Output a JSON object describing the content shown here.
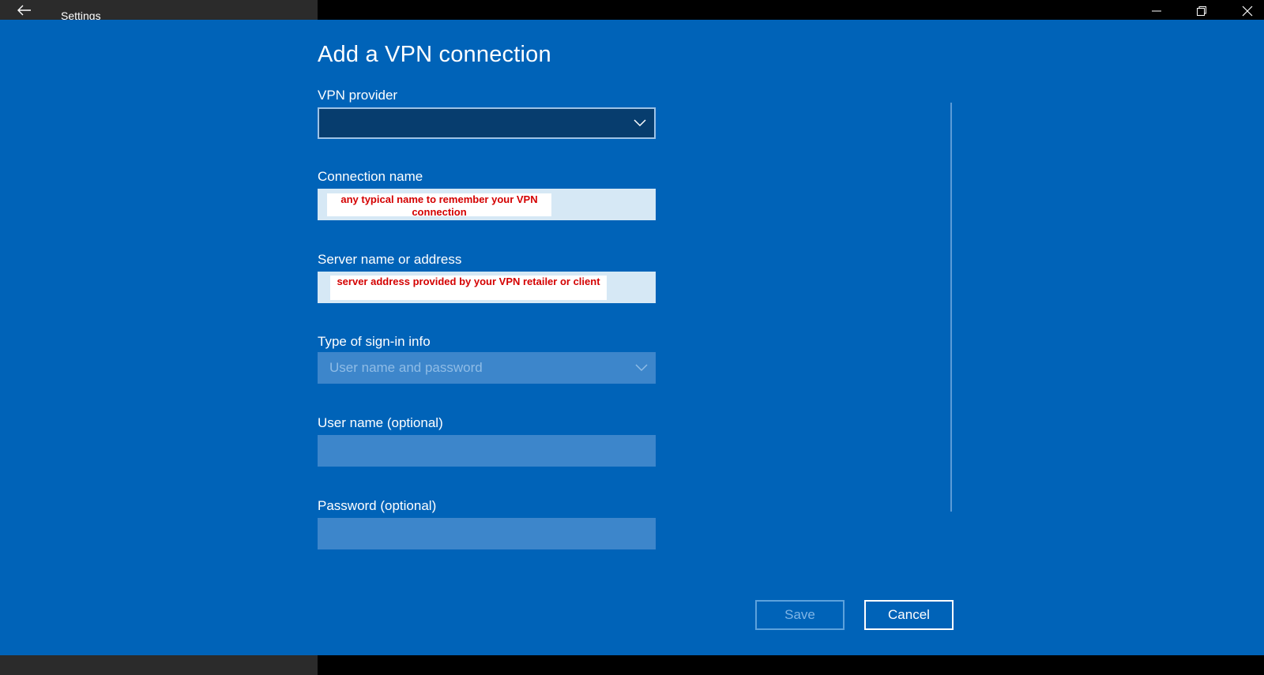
{
  "window": {
    "app_title": "Settings"
  },
  "dialog": {
    "heading": "Add a VPN connection",
    "vpn_provider": {
      "label": "VPN provider",
      "value": ""
    },
    "connection_name": {
      "label": "Connection name",
      "annotation": "any typical name to remember your VPN connection"
    },
    "server": {
      "label": "Server name or address",
      "annotation": "server address provided by your VPN retailer or client"
    },
    "sign_in_type": {
      "label": "Type of sign-in info",
      "value": "User name and password"
    },
    "username": {
      "label": "User name (optional)",
      "value": ""
    },
    "password": {
      "label": "Password (optional)",
      "value": ""
    },
    "buttons": {
      "save": "Save",
      "cancel": "Cancel"
    }
  },
  "colors": {
    "dialog_background": "#0063b8",
    "annotation_text": "#d40000"
  },
  "icons": {
    "back": "back-arrow-icon",
    "dropdown": "chevron-down-icon",
    "minimize": "minimize-icon",
    "restore": "restore-icon",
    "close": "close-icon"
  }
}
